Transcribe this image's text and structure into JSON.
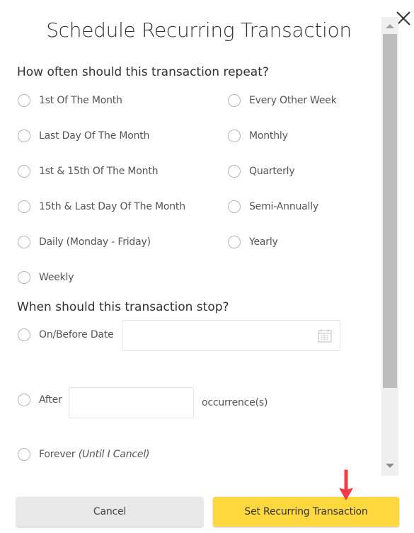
{
  "dialog": {
    "title": "Schedule Recurring Transaction",
    "close_icon": "close-icon"
  },
  "repeat": {
    "heading": "How often should this transaction repeat?",
    "left_options": [
      {
        "label": "1st Of The Month",
        "selected": false
      },
      {
        "label": "Last Day Of The Month",
        "selected": false
      },
      {
        "label": "1st & 15th Of The Month",
        "selected": false
      },
      {
        "label": "15th & Last Day Of The Month",
        "selected": false
      },
      {
        "label": "Daily (Monday - Friday)",
        "selected": false
      },
      {
        "label": "Weekly",
        "selected": false
      }
    ],
    "right_options": [
      {
        "label": "Every Other Week",
        "selected": false
      },
      {
        "label": "Monthly",
        "selected": false
      },
      {
        "label": "Quarterly",
        "selected": false
      },
      {
        "label": "Semi-Annually",
        "selected": false
      },
      {
        "label": "Yearly",
        "selected": false
      }
    ]
  },
  "stop": {
    "heading": "When should this transaction stop?",
    "on_before_date": {
      "label": "On/Before Date",
      "value": "",
      "icon": "calendar-icon"
    },
    "after": {
      "label": "After",
      "value": "",
      "suffix": "occurrence(s)"
    },
    "forever": {
      "label": "Forever",
      "note": "(Until I Cancel)"
    }
  },
  "buttons": {
    "cancel": "Cancel",
    "submit": "Set Recurring Transaction"
  },
  "colors": {
    "primary_button": "#ffd83d",
    "secondary_button": "#e8e8e8",
    "annotation_arrow": "#f03c46"
  }
}
